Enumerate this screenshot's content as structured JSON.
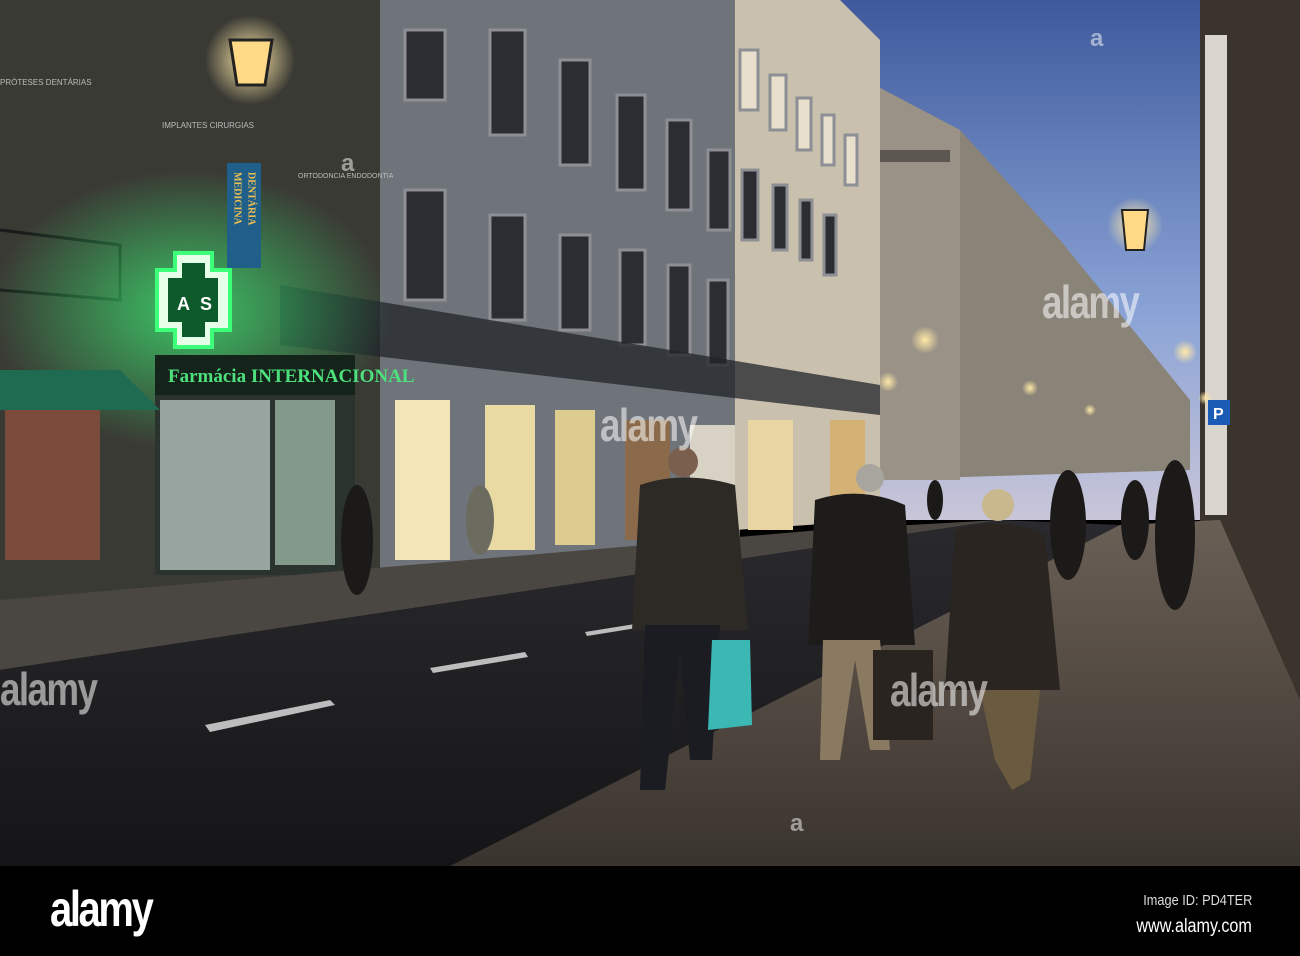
{
  "scene": {
    "pharmacy_sign": "Farmácia INTERNACIONAL",
    "cross_letters": [
      "A",
      "S"
    ],
    "dental_sign_left": "MEDICINA",
    "dental_sign_right": "DENTÁRIA",
    "window_sign_1": "IMPLANTES CIRURGIAS",
    "window_sign_2": "ORTODONCIA ENDODONTIA",
    "window_sign_3": "PRÓTESES DENTÁRIAS",
    "parking_sign": "P"
  },
  "watermark": {
    "overlay_text": "alamy",
    "overlay_letter": "a"
  },
  "footer": {
    "logo": "alamy",
    "image_id": "Image ID: PD4TER",
    "website": "www.alamy.com"
  }
}
